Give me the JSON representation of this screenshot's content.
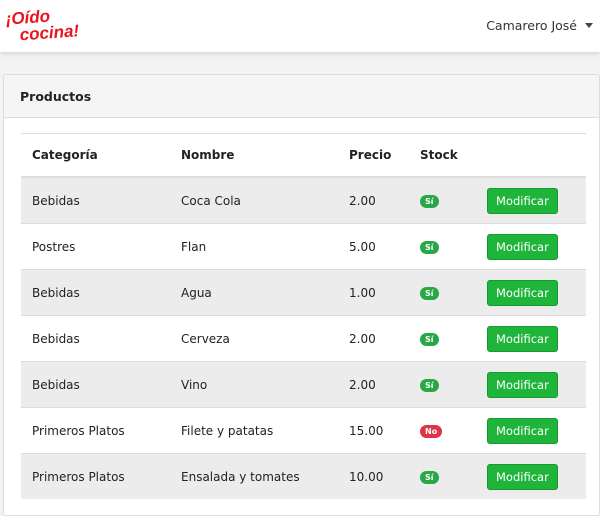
{
  "header": {
    "logo_line1": "¡Oído",
    "logo_line2": "cocina!",
    "user_name": "Camarero José"
  },
  "panel": {
    "title": "Productos"
  },
  "table": {
    "headers": [
      "Categoría",
      "Nombre",
      "Precio",
      "Stock"
    ],
    "rows": [
      {
        "category": "Bebidas",
        "name": "Coca Cola",
        "price": "2.00",
        "stock": "Sí",
        "action": "Modificar"
      },
      {
        "category": "Postres",
        "name": "Flan",
        "price": "5.00",
        "stock": "Sí",
        "action": "Modificar"
      },
      {
        "category": "Bebidas",
        "name": "Agua",
        "price": "1.00",
        "stock": "Sí",
        "action": "Modificar"
      },
      {
        "category": "Bebidas",
        "name": "Cerveza",
        "price": "2.00",
        "stock": "Sí",
        "action": "Modificar"
      },
      {
        "category": "Bebidas",
        "name": "Vino",
        "price": "2.00",
        "stock": "Sí",
        "action": "Modificar"
      },
      {
        "category": "Primeros Platos",
        "name": "Filete y patatas",
        "price": "15.00",
        "stock": "No",
        "action": "Modificar"
      },
      {
        "category": "Primeros Platos",
        "name": "Ensalada y tomates",
        "price": "10.00",
        "stock": "Sí",
        "action": "Modificar"
      }
    ]
  },
  "colors": {
    "brand": "#e8141e",
    "button": "#1eb53a",
    "badge_yes": "#28a745",
    "badge_no": "#dc3545"
  }
}
